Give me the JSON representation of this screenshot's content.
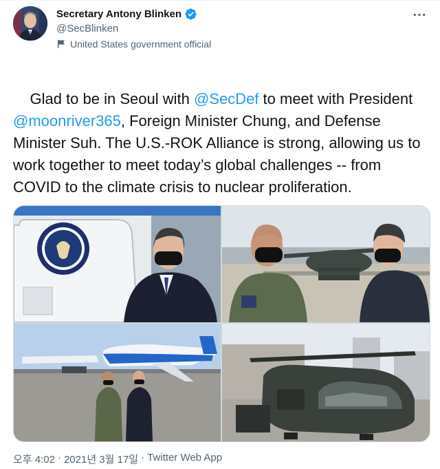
{
  "author": {
    "display_name": "Secretary Antony Blinken",
    "handle": "@SecBlinken",
    "label": "United States government official",
    "verified_icon": "verified-badge-icon",
    "label_icon": "flag-icon"
  },
  "tweet": {
    "segments": [
      {
        "text": "Glad to be in Seoul with ",
        "mention": false
      },
      {
        "text": "@SecDef",
        "mention": true
      },
      {
        "text": " to meet with President ",
        "mention": false
      },
      {
        "text": "@moonriver365",
        "mention": true
      },
      {
        "text": ", Foreign Minister Chung, and Defense Minister Suh. The U.S.-ROK Alliance is strong, allowing us to work together to meet today’s global challenges -- from COVID to the climate crisis to nuclear proliferation.",
        "mention": false
      }
    ]
  },
  "media": {
    "seal_text": "SECRETARY OF STATE"
  },
  "footer": {
    "time": "오후 4:02",
    "separator": "·",
    "date": "2021년 3월 17일",
    "source": "Twitter Web App"
  },
  "colors": {
    "accent": "#1d9bf0",
    "text": "#0f1419",
    "muted": "#536471"
  }
}
